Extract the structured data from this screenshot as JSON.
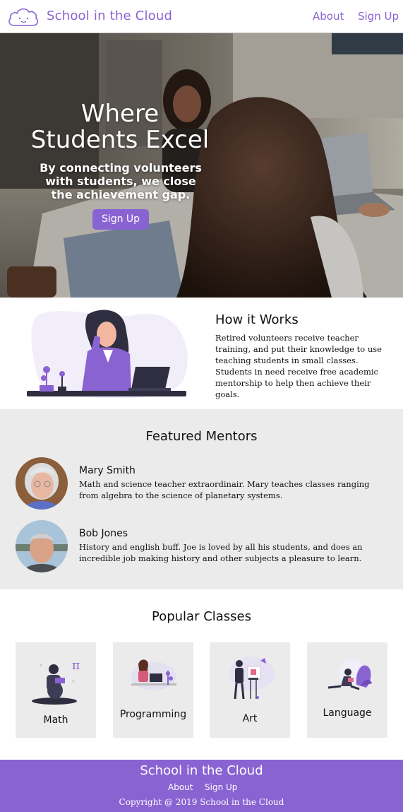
{
  "header": {
    "brand": "School in the Cloud",
    "nav": {
      "about": "About",
      "signup": "Sign Up"
    },
    "logo_icon": "cloud-smile-icon"
  },
  "hero": {
    "title_line1": "Where",
    "title_line2": "Students Excel",
    "subtitle": "By connecting volunteers with students, we close the achievement gap.",
    "cta": "Sign Up"
  },
  "how": {
    "title": "How it Works",
    "text": "Retired volunteers receive teacher training, and put their knowledge to use teaching students in small classes. Students in need receive free academic mentorship to help then achieve their goals."
  },
  "mentors": {
    "title": "Featured Mentors",
    "items": [
      {
        "name": "Mary Smith",
        "bio": "Math and science teacher extraordinair. Mary teaches classes ranging from algebra to the science of planetary systems."
      },
      {
        "name": "Bob Jones",
        "bio": "History and english buff. Joe is loved by all his students, and does an incredible job making history and other subjects a pleasure to learn."
      }
    ]
  },
  "classes": {
    "title": "Popular Classes",
    "items": [
      {
        "label": "Math"
      },
      {
        "label": "Programming"
      },
      {
        "label": "Art"
      },
      {
        "label": "Language"
      }
    ]
  },
  "footer": {
    "brand": "School in the Cloud",
    "about": "About",
    "signup": "Sign Up",
    "copyright": "Copyright @ 2019 School in the Cloud"
  },
  "colors": {
    "accent": "#8a63d2",
    "section_gray": "#ebebeb"
  }
}
